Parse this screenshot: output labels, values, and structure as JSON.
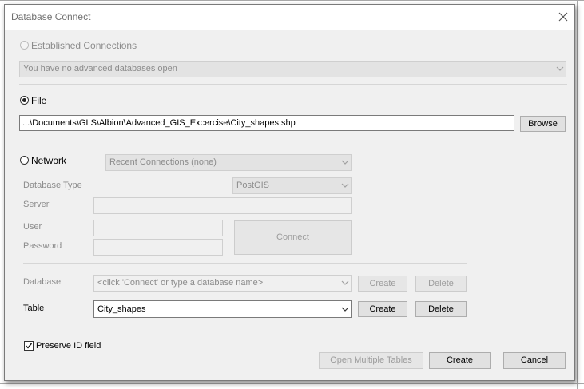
{
  "dialog": {
    "title": "Database Connect"
  },
  "established": {
    "label": "Established Connections",
    "dropdown_value": "You have no advanced databases open"
  },
  "file": {
    "label": "File",
    "path": "...\\Documents\\GLS\\Albion\\Advanced_GIS_Excercise\\City_shapes.shp",
    "browse_label": "Browse"
  },
  "network": {
    "label": "Network",
    "recent_connections": "Recent Connections (none)",
    "database_type_label": "Database Type",
    "database_type_value": "PostGIS",
    "server_label": "Server",
    "user_label": "User",
    "password_label": "Password",
    "connect_label": "Connect"
  },
  "database": {
    "label": "Database",
    "value": "<click 'Connect' or type a database name>",
    "create_label": "Create",
    "delete_label": "Delete"
  },
  "table": {
    "label": "Table",
    "value": "City_shapes",
    "create_label": "Create",
    "delete_label": "Delete"
  },
  "footer": {
    "preserve_label": "Preserve ID field",
    "open_multiple_label": "Open Multiple Tables",
    "create_label": "Create",
    "cancel_label": "Cancel"
  }
}
